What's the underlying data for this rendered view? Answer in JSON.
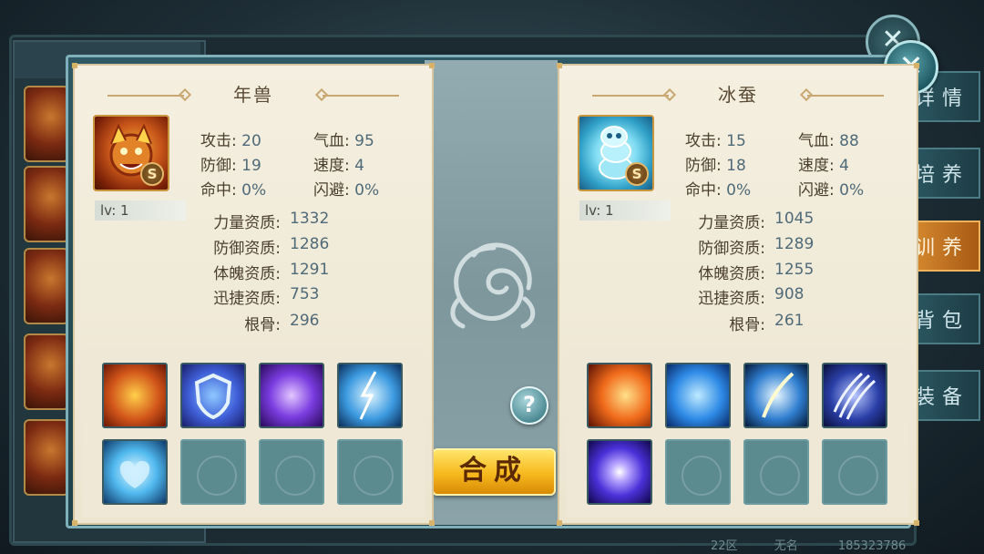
{
  "background": {
    "side_tabs": [
      "详情",
      "培养",
      "训养",
      "背包",
      "装备"
    ],
    "active_tab_index": 2,
    "footer": {
      "zone": "22区",
      "name": "无名",
      "id": "185323786"
    }
  },
  "left_pet": {
    "name": "年兽",
    "grade": "S",
    "level": "lv: 1",
    "stats": [
      {
        "label": "攻击:",
        "value": "20"
      },
      {
        "label": "气血:",
        "value": "95"
      },
      {
        "label": "防御:",
        "value": "19"
      },
      {
        "label": "速度:",
        "value": "4"
      },
      {
        "label": "命中:",
        "value": "0%"
      },
      {
        "label": "闪避:",
        "value": "0%"
      }
    ],
    "aptitudes": [
      {
        "label": "力量资质:",
        "value": "1332"
      },
      {
        "label": "防御资质:",
        "value": "1286"
      },
      {
        "label": "体魄资质:",
        "value": "1291"
      },
      {
        "label": "迅捷资质:",
        "value": "753"
      },
      {
        "label": "根骨:",
        "value": "296"
      }
    ],
    "skills": [
      "fire-fist-skill-icon",
      "shield-skill-icon",
      "purple-vortex-skill-icon",
      "lightning-skill-icon",
      "water-heart-skill-icon",
      "empty",
      "empty",
      "empty"
    ]
  },
  "right_pet": {
    "name": "冰蚕",
    "grade": "S",
    "level": "lv: 1",
    "stats": [
      {
        "label": "攻击:",
        "value": "15"
      },
      {
        "label": "气血:",
        "value": "88"
      },
      {
        "label": "防御:",
        "value": "18"
      },
      {
        "label": "速度:",
        "value": "4"
      },
      {
        "label": "命中:",
        "value": "0%"
      },
      {
        "label": "闪避:",
        "value": "0%"
      }
    ],
    "aptitudes": [
      {
        "label": "力量资质:",
        "value": "1045"
      },
      {
        "label": "防御资质:",
        "value": "1289"
      },
      {
        "label": "体魄资质:",
        "value": "1255"
      },
      {
        "label": "迅捷资质:",
        "value": "908"
      },
      {
        "label": "根骨:",
        "value": "261"
      }
    ],
    "skills": [
      "phoenix-fire-skill-icon",
      "ice-beast-skill-icon",
      "blue-slash-skill-icon",
      "claw-skill-icon",
      "energy-orb-skill-icon",
      "empty",
      "empty",
      "empty"
    ]
  },
  "actions": {
    "merge_label": "合成",
    "help_label": "?",
    "close_label": "✕"
  },
  "colors": {
    "merge_button": "#f6b81c",
    "panel_bg": "#f4efe0",
    "frame": "#2e5964",
    "active_tab": "#d4882e"
  }
}
